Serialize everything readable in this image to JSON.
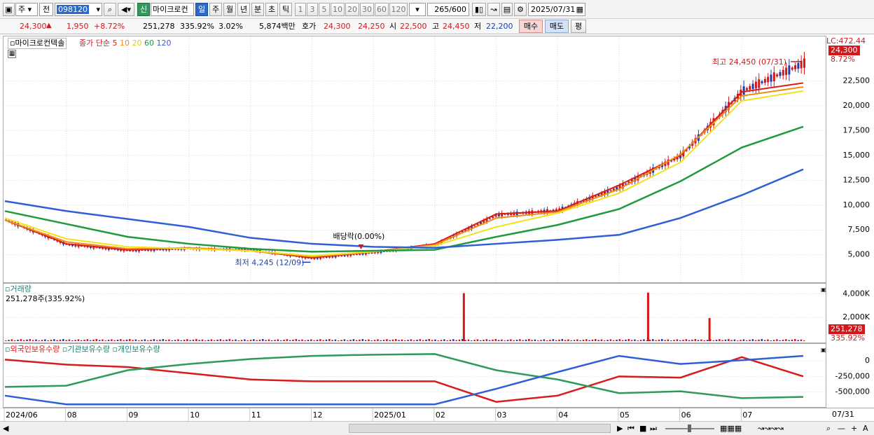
{
  "toolbar": {
    "market": "주",
    "prev_label": "전",
    "code": "098120",
    "stock_name": "마이크로컨",
    "new_badge": "신",
    "period_tabs": [
      "일",
      "주",
      "월",
      "년",
      "분",
      "초",
      "틱"
    ],
    "active_period": "일",
    "interval_nums": [
      "1",
      "3",
      "5",
      "10",
      "20",
      "30",
      "60",
      "120"
    ],
    "count": "265",
    "count_max": "/600",
    "date": "2025/07/31"
  },
  "quote": {
    "price": "24,300",
    "change": "1,950",
    "change_pct": "+8.72%",
    "volume": "251,278",
    "volume_ratio": "335.92%",
    "turnover": "3.02%",
    "amount": "5,874백만",
    "ask_label": "호가",
    "ask": "24,300",
    "bid": "24,250",
    "open_label": "시",
    "open": "22,500",
    "high_label": "고",
    "high": "24,450",
    "low_label": "저",
    "low": "22,200",
    "buy_label": "매수",
    "sell_label": "매도",
    "eval_label": "평"
  },
  "legends": {
    "price_name": "마이크로컨텍솔",
    "ma_title": "종가 단순",
    "ma_periods": [
      "5",
      "10",
      "20",
      "60",
      "120"
    ],
    "volume_title": "거래량",
    "volume_info": "251,278주(335.92%)",
    "holdings": [
      "외국인보유수량",
      "기관보유수량",
      "개인보유수량"
    ]
  },
  "annotations": {
    "high_label": "최고 24,450 (07/31)",
    "low_label": "최저 4,245 (12/09)",
    "dividend_label": "배당락(0.00%)",
    "lc_label": "LC:472.44",
    "price_tag": "24,300",
    "pct_tag": "8.72%",
    "vol_tag": "251,278",
    "vol_pct_tag": "335.92%"
  },
  "colors": {
    "up": "#d2181b",
    "down": "#1a3fb0",
    "ma5": "#d81b1b",
    "ma10": "#f08c14",
    "ma20": "#f2e21a",
    "ma60": "#1f9a3c",
    "ma120": "#2f5fd6",
    "foreign": "#d81b1b",
    "institution": "#2f9a5b",
    "individual": "#2f5fd6"
  },
  "chart_data": [
    {
      "type": "candlestick",
      "title": "마이크로컨텍솔",
      "x": [
        "2024/06",
        "08",
        "09",
        "10",
        "11",
        "12",
        "2025/01",
        "02",
        "03",
        "04",
        "05",
        "06",
        "07",
        "07/31"
      ],
      "close": [
        8500,
        6000,
        5400,
        5600,
        5500,
        4600,
        5200,
        6000,
        9000,
        9500,
        11800,
        15000,
        21500,
        24300
      ],
      "ma_series": [
        {
          "name": "5",
          "values": [
            8500,
            6100,
            5500,
            5700,
            5400,
            4700,
            5300,
            6100,
            9100,
            9400,
            12000,
            15000,
            21400,
            22300
          ]
        },
        {
          "name": "10",
          "values": [
            8500,
            6300,
            5600,
            5700,
            5400,
            4800,
            5300,
            6000,
            8700,
            9300,
            11600,
            15100,
            21000,
            21900
          ]
        },
        {
          "name": "20",
          "values": [
            8700,
            6600,
            5800,
            5600,
            5400,
            4900,
            5300,
            5900,
            7800,
            9200,
            11200,
            14300,
            20500,
            21500
          ]
        },
        {
          "name": "60",
          "values": [
            9400,
            8100,
            6800,
            6100,
            5600,
            5300,
            5400,
            5500,
            6800,
            8000,
            9600,
            12400,
            15800,
            17900
          ]
        },
        {
          "name": "120",
          "values": [
            10400,
            9400,
            8600,
            7800,
            6700,
            6100,
            5800,
            5700,
            6100,
            6500,
            7000,
            8700,
            11000,
            13600
          ]
        }
      ],
      "ylim": [
        3000,
        26000
      ],
      "yticks": [
        5000,
        7500,
        10000,
        12500,
        15000,
        17500,
        20000,
        22500
      ]
    },
    {
      "type": "bar",
      "title": "거래량",
      "ylim": [
        0,
        4500000
      ],
      "yticks_labels": [
        "2,000K",
        "4,000K"
      ],
      "yticks": [
        2000000,
        4000000
      ],
      "spikes": [
        {
          "x": "2025/02",
          "value": 4050000
        },
        {
          "x": "05",
          "value": 4100000
        },
        {
          "x": "06",
          "value": 1950000
        }
      ],
      "last": 251278
    },
    {
      "type": "line",
      "series": [
        {
          "name": "외국인보유수량",
          "values": [
            20000,
            -60000,
            -100000,
            -200000,
            -300000,
            -330000,
            -330000,
            -330000,
            -660000,
            -560000,
            -250000,
            -270000,
            60000,
            -250000
          ]
        },
        {
          "name": "기관보유수량",
          "values": [
            -420000,
            -400000,
            -150000,
            -50000,
            30000,
            80000,
            100000,
            110000,
            -150000,
            -300000,
            -520000,
            -490000,
            -600000,
            -580000
          ]
        },
        {
          "name": "개인보유수량",
          "values": [
            -560000,
            -700000,
            -700000,
            -700000,
            -700000,
            -700000,
            -700000,
            -700000,
            -450000,
            -180000,
            80000,
            -50000,
            10000,
            80000
          ]
        }
      ],
      "ylim": [
        -720000,
        160000
      ],
      "yticks_labels": [
        "0",
        "-250,000",
        "-500,000"
      ],
      "yticks": [
        0,
        -250000,
        -500000
      ]
    }
  ]
}
